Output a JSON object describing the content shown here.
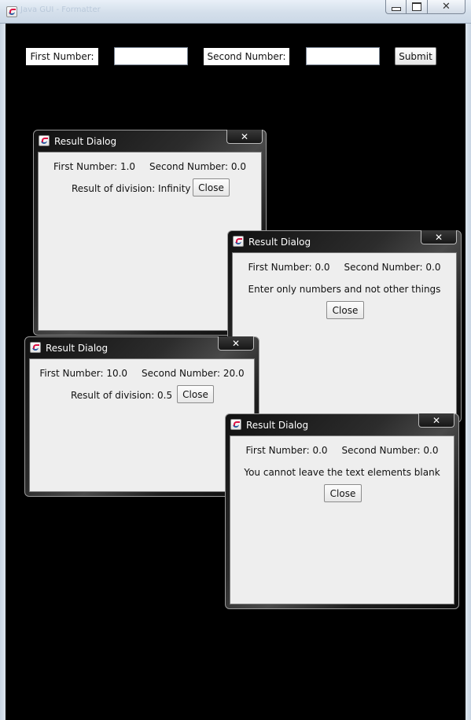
{
  "window": {
    "title": "Java GUI - Formatter",
    "controls": {
      "minimize_icon": "minimize-icon",
      "maximize_icon": "maximize-icon",
      "close_icon": "close-icon"
    }
  },
  "form": {
    "first_label": "First Number:",
    "first_value": "",
    "second_label": "Second Number:",
    "second_value": "",
    "submit_label": "Submit"
  },
  "dialogs": [
    {
      "title": "Result Dialog",
      "close_glyph": "x",
      "first": "First Number: 1.0",
      "second": "Second Number: 0.0",
      "message": "Result of division: Infinity",
      "close_label": "Close"
    },
    {
      "title": "Result Dialog",
      "close_glyph": "x",
      "first": "First Number: 0.0",
      "second": "Second Number: 0.0",
      "message": "Enter only numbers and not other things",
      "close_label": "Close"
    },
    {
      "title": "Result Dialog",
      "close_glyph": "x",
      "first": "First Number: 10.0",
      "second": "Second Number: 20.0",
      "message": "Result of division: 0.5",
      "close_label": "Close"
    },
    {
      "title": "Result Dialog",
      "close_glyph": "x",
      "first": "First Number: 0.0",
      "second": "Second Number: 0.0",
      "message": "You cannot leave the text elements blank",
      "close_label": "Close"
    }
  ],
  "colors": {
    "background": "#000000",
    "dialog_body": "#eeeeee"
  }
}
